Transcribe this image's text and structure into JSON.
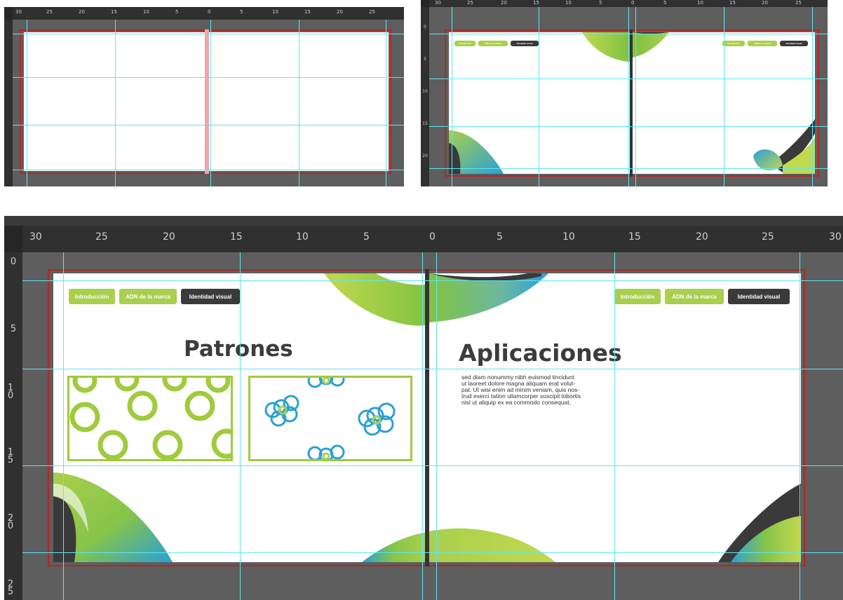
{
  "document": {
    "left_page": {
      "heading": "Patrones",
      "nav": [
        "Introducción",
        "ADN de la marca",
        "Identidad visual"
      ]
    },
    "right_page": {
      "heading": "Aplicaciones",
      "nav": [
        "Introducción",
        "ADN de la marca",
        "Identidad visual"
      ],
      "body_lines": [
        "sed diam nonummy nibh euismod tincidunt",
        "ut laoreet dolore magna aliquam erat volut-",
        "pat. Ut wisi enim ad minim veniam, quis nos-",
        "trud exerci tation ullamcorper suscipit lobortis",
        "nisl ut aliquip ex ea commodo consequat."
      ]
    }
  },
  "ruler": {
    "top_labels": [
      "30",
      "25",
      "20",
      "15",
      "10",
      "5",
      "0",
      "5",
      "10",
      "15",
      "20",
      "25",
      "30"
    ],
    "left_labels_main": [
      "0",
      "5",
      "10",
      "15",
      "20",
      "25"
    ],
    "left_labels_small_a": [
      "0",
      "5",
      "10"
    ],
    "left_labels_small_b": [
      "0",
      "5",
      "10",
      "15",
      "20"
    ]
  },
  "colors": {
    "canvas": "#5e5e5e",
    "ruler": "#303030",
    "guide": "#60e6f0",
    "bleed": "#b52525",
    "accent_green": "#a9cf4d",
    "accent_dark": "#3a3a3a",
    "gradient_blue": "#2a9fd6"
  }
}
